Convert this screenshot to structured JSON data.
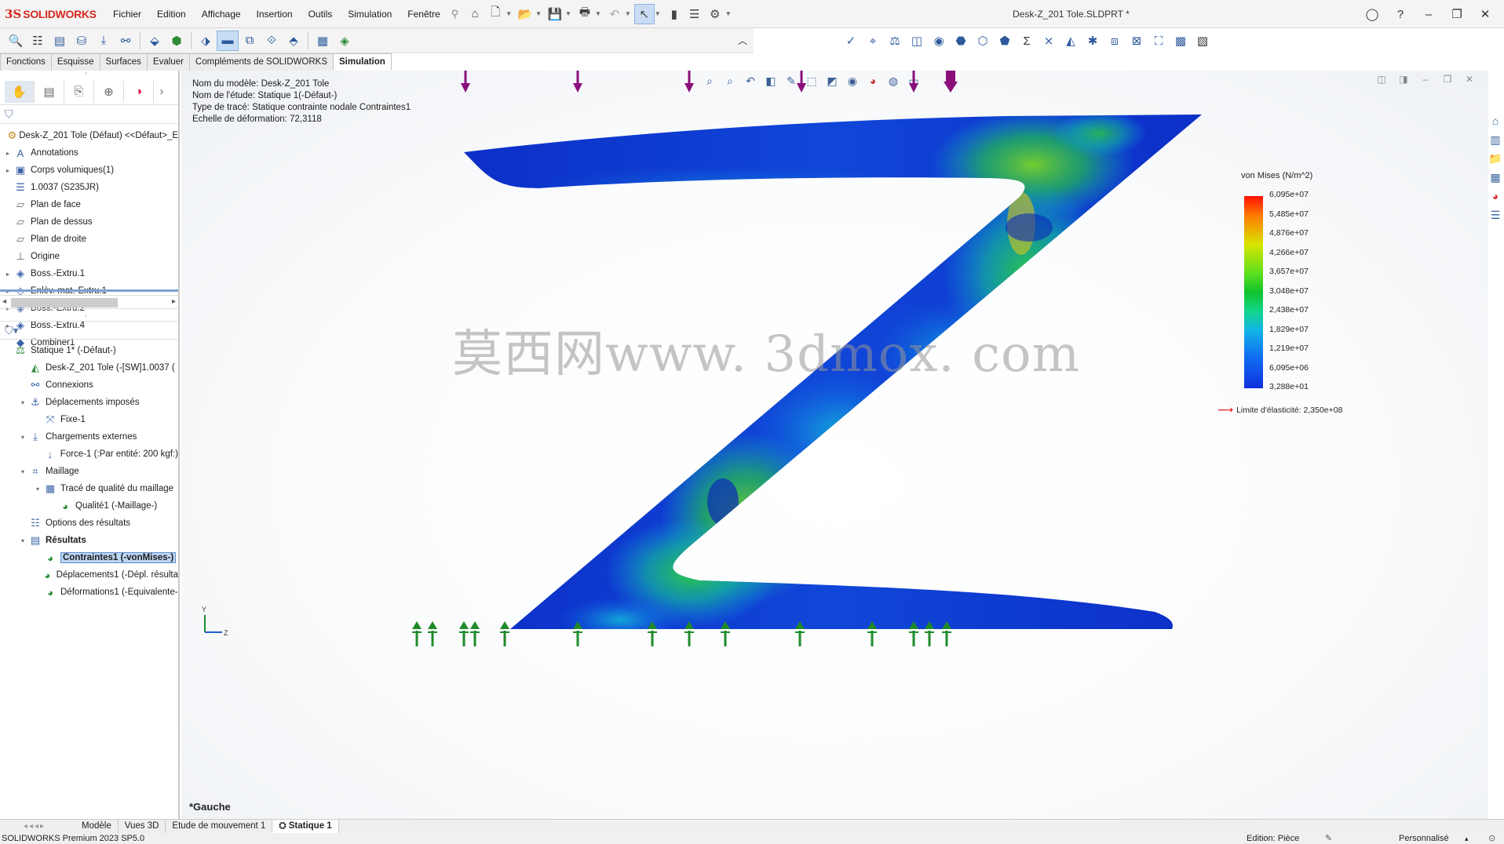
{
  "app": {
    "brand_ds": "3S",
    "brand": "SOLIDWORKS",
    "doc_title": "Desk-Z_201 Tole.SLDPRT *"
  },
  "menu": [
    "Fichier",
    "Edition",
    "Affichage",
    "Insertion",
    "Outils",
    "Simulation",
    "Fenêtre"
  ],
  "tabs": [
    "Fonctions",
    "Esquisse",
    "Surfaces",
    "Evaluer",
    "Compléments de SOLIDWORKS",
    "Simulation"
  ],
  "active_tab": "Simulation",
  "feature_tree": [
    {
      "label": "Desk-Z_201 Tole (Défaut) <<Défaut>_E",
      "icon": "part-icon",
      "expand": ""
    },
    {
      "label": "Annotations",
      "icon": "annotations-icon",
      "expand": "▸"
    },
    {
      "label": "Corps volumiques(1)",
      "icon": "solid-bodies-icon",
      "expand": "▸"
    },
    {
      "label": "1.0037 (S235JR)",
      "icon": "material-icon",
      "expand": ""
    },
    {
      "label": "Plan de face",
      "icon": "plane-icon",
      "expand": ""
    },
    {
      "label": "Plan de dessus",
      "icon": "plane-icon",
      "expand": ""
    },
    {
      "label": "Plan de droite",
      "icon": "plane-icon",
      "expand": ""
    },
    {
      "label": "Origine",
      "icon": "origin-icon",
      "expand": ""
    },
    {
      "label": "Boss.-Extru.1",
      "icon": "extrude-icon",
      "expand": "▸"
    },
    {
      "label": "Enlèv. mat.-Extru.1",
      "icon": "cut-extrude-icon",
      "expand": "▸"
    },
    {
      "label": "Boss.-Extru.2",
      "icon": "extrude-icon",
      "expand": "▸"
    },
    {
      "label": "Boss.-Extru.4",
      "icon": "extrude-icon",
      "expand": "▸"
    },
    {
      "label": "Combiner1",
      "icon": "combine-icon",
      "expand": ""
    }
  ],
  "study_tree": [
    {
      "label": "Statique 1* (-Défaut-)",
      "indent": 0,
      "expand": "",
      "icon": "study-icon"
    },
    {
      "label": "Desk-Z_201 Tole (-[SW]1.0037 (",
      "indent": 1,
      "expand": "",
      "icon": "part-body-icon"
    },
    {
      "label": "Connexions",
      "indent": 1,
      "expand": "",
      "icon": "connections-icon"
    },
    {
      "label": "Déplacements imposés",
      "indent": 1,
      "expand": "▾",
      "icon": "fixtures-icon"
    },
    {
      "label": "Fixe-1",
      "indent": 2,
      "expand": "",
      "icon": "fixed-icon"
    },
    {
      "label": "Chargements externes",
      "indent": 1,
      "expand": "▾",
      "icon": "external-loads-icon"
    },
    {
      "label": "Force-1 (:Par entité: 200 kgf:)",
      "indent": 2,
      "expand": "",
      "icon": "force-icon"
    },
    {
      "label": "Maillage",
      "indent": 1,
      "expand": "▾",
      "icon": "mesh-icon"
    },
    {
      "label": "Tracé de qualité du maillage",
      "indent": 2,
      "expand": "▾",
      "icon": "mesh-plot-icon"
    },
    {
      "label": "Qualité1 (-Maillage-)",
      "indent": 3,
      "expand": "",
      "icon": "quality-icon"
    },
    {
      "label": "Options des résultats",
      "indent": 1,
      "expand": "",
      "icon": "result-options-icon"
    },
    {
      "label": "Résultats",
      "indent": 1,
      "expand": "▾",
      "icon": "results-icon",
      "bold": true
    },
    {
      "label": "Contraintes1 (-vonMises-)",
      "indent": 2,
      "expand": "",
      "icon": "stress-plot-icon",
      "selected": true
    },
    {
      "label": "Déplacements1 (-Dépl. résulta",
      "indent": 2,
      "expand": "",
      "icon": "displacement-plot-icon"
    },
    {
      "label": "Déformations1 (-Equivalente-",
      "indent": 2,
      "expand": "",
      "icon": "strain-plot-icon"
    }
  ],
  "plot_info": [
    "Nom du modèle: Desk-Z_201 Tole",
    "Nom de l'étude: Statique 1(-Défaut-)",
    "Type de tracé: Statique contrainte nodale Contraintes1",
    "Echelle de déformation: 72,3118"
  ],
  "legend": {
    "title": "von Mises (N/m^2)",
    "values": [
      "6,095e+07",
      "5,485e+07",
      "4,876e+07",
      "4,266e+07",
      "3,657e+07",
      "3,048e+07",
      "2,438e+07",
      "1,829e+07",
      "1,219e+07",
      "6,095e+06",
      "3,288e+01"
    ],
    "yield_label": "Limite d'élasticité: 2,350e+08",
    "max_color": "#ff1000",
    "min_color": "#1030e0"
  },
  "watermark": "莫西网www. 3dmox. com",
  "view_label": "*Gauche",
  "triad": {
    "y": "Y",
    "z": "Z"
  },
  "bottom_tabs": [
    "Modèle",
    "Vues 3D",
    "Etude de mouvement 1",
    "Statique 1"
  ],
  "active_bottom_tab": "Statique 1",
  "status": {
    "version": "SOLIDWORKS Premium 2023 SP5.0",
    "edit": "Edition: Pièce",
    "units": "Personnalisé"
  },
  "colors": {
    "load_arrow": "#8a0f7a",
    "fixture": "#1f8a2a",
    "accent": "#7aa1d2"
  }
}
